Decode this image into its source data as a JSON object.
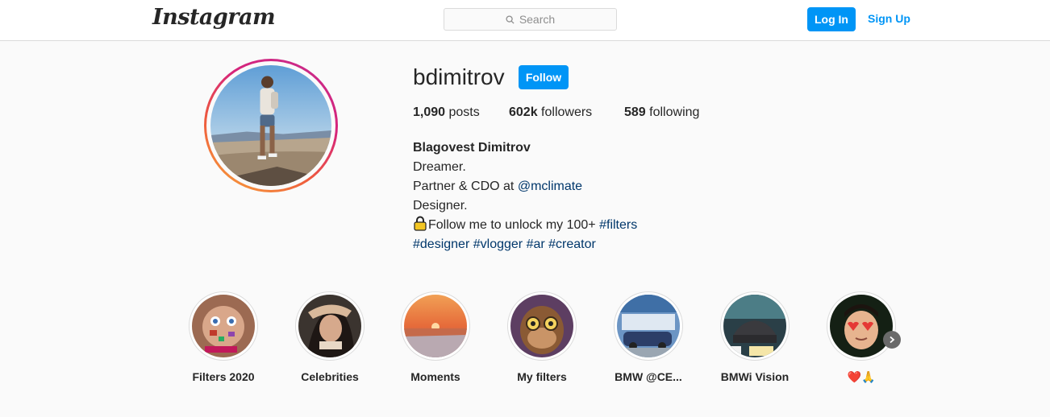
{
  "header": {
    "logo_text": "Instagram",
    "search_placeholder": "Search",
    "login_label": "Log In",
    "signup_label": "Sign Up"
  },
  "profile": {
    "username": "bdimitrov",
    "follow_label": "Follow",
    "stats": {
      "posts_count": "1,090",
      "posts_label": "posts",
      "followers_count": "602k",
      "followers_label": "followers",
      "following_count": "589",
      "following_label": "following"
    },
    "bio": {
      "full_name": "Blagovest Dimitrov",
      "line1": "Dreamer.",
      "line2_prefix": "Partner & CDO at ",
      "line2_mention": "@mclimate",
      "line3": "Designer.",
      "line4_text": "Follow me to unlock my 100+ ",
      "line4_tag": "#filters",
      "tags": [
        "#designer",
        "#vlogger",
        "#ar",
        "#creator"
      ]
    }
  },
  "highlights": [
    {
      "label": "Filters 2020"
    },
    {
      "label": "Celebrities"
    },
    {
      "label": "Moments"
    },
    {
      "label": "My filters"
    },
    {
      "label": "BMW @CE..."
    },
    {
      "label": "BMWi Vision"
    },
    {
      "label": "❤️🙏"
    }
  ],
  "icons": {
    "search": "search-icon",
    "lock": "lock-icon",
    "next": "chevron-right-icon"
  },
  "colors": {
    "accent": "#0095f6",
    "link": "#00376b",
    "ring_gradient": [
      "#f9a93a",
      "#ee5a3d",
      "#d6247a",
      "#c62c8f"
    ]
  }
}
